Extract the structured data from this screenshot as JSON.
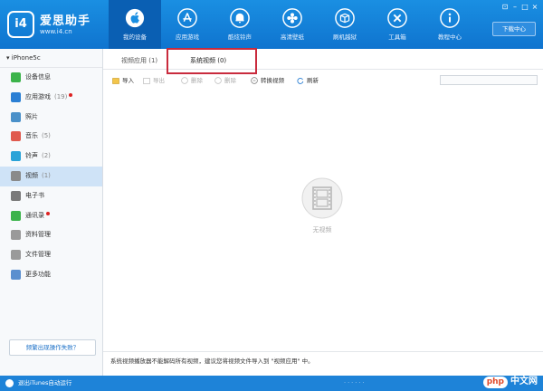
{
  "app": {
    "logo_mark": "i4",
    "name": "爱思助手",
    "url": "www.i4.cn",
    "download_label": "下载中心",
    "win_controls": [
      "⊡",
      "–",
      "□",
      "×"
    ]
  },
  "nav": {
    "items": [
      {
        "label": "我的设备",
        "icon": "apple-icon"
      },
      {
        "label": "应用游戏",
        "icon": "app-store-icon"
      },
      {
        "label": "酷炫铃声",
        "icon": "bell-icon"
      },
      {
        "label": "高清壁纸",
        "icon": "flower-icon"
      },
      {
        "label": "刷机越狱",
        "icon": "box-icon"
      },
      {
        "label": "工具箱",
        "icon": "tools-icon"
      },
      {
        "label": "教程中心",
        "icon": "info-icon"
      }
    ]
  },
  "sidebar": {
    "device_name": "iPhone5c",
    "items": [
      {
        "label": "设备信息",
        "count": "",
        "color": "#3bb34a",
        "badge": false
      },
      {
        "label": "应用游戏",
        "count": "(19)",
        "color": "#2a7fd4",
        "badge": true
      },
      {
        "label": "照片",
        "count": "",
        "color": "#4a90c9",
        "badge": false
      },
      {
        "label": "音乐",
        "count": "(5)",
        "color": "#e05a4e",
        "badge": false
      },
      {
        "label": "铃声",
        "count": "(2)",
        "color": "#2aa3d8",
        "badge": false
      },
      {
        "label": "视频",
        "count": "(1)",
        "color": "#8a8a8a",
        "badge": false
      },
      {
        "label": "电子书",
        "count": "",
        "color": "#7a7a7a",
        "badge": false
      },
      {
        "label": "通讯录",
        "count": "",
        "color": "#3bb34a",
        "badge": true
      },
      {
        "label": "资料管理",
        "count": "",
        "color": "#9a9a9a",
        "badge": false
      },
      {
        "label": "文件管理",
        "count": "",
        "color": "#9a9a9a",
        "badge": false
      },
      {
        "label": "更多功能",
        "count": "",
        "color": "#5a8fcf",
        "badge": false
      }
    ],
    "feedback_label": "频繁出现操作失败？"
  },
  "main": {
    "tabs": [
      {
        "label": "视频应用 (1)"
      },
      {
        "label": "系统视频 (0)"
      }
    ],
    "toolbar": [
      {
        "label": "导入",
        "enabled": true
      },
      {
        "label": "导出",
        "enabled": false
      },
      {
        "label": "删除",
        "enabled": false
      },
      {
        "label": "删除",
        "enabled": false
      },
      {
        "label": "转换视频",
        "enabled": true
      },
      {
        "label": "刷新",
        "enabled": true
      }
    ],
    "empty_text": "无视频",
    "notice": "系统视频播放器不能解码所有视频，建议您将视频文件导入到 \"视频应用\" 中。"
  },
  "status": {
    "itunes_text": "退出iTunes自动运行",
    "dots": "······",
    "watermark_brand": "php",
    "watermark_cn": "中文网"
  },
  "colors": {
    "header": "#1a8fe2",
    "accent": "#1e83d8",
    "highlight": "#c92b3d",
    "sidebar_active": "#cfe3f7"
  }
}
